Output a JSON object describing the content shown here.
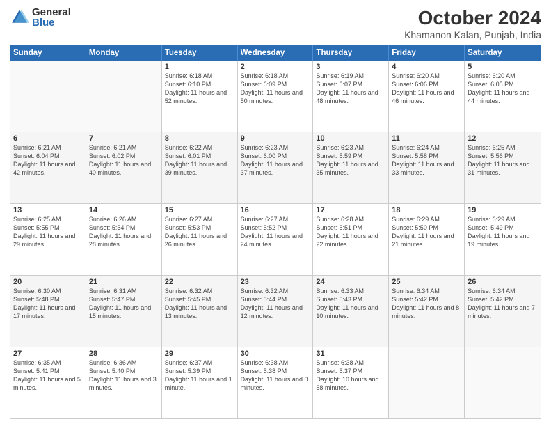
{
  "logo": {
    "general": "General",
    "blue": "Blue"
  },
  "title": "October 2024",
  "subtitle": "Khamanon Kalan, Punjab, India",
  "header_days": [
    "Sunday",
    "Monday",
    "Tuesday",
    "Wednesday",
    "Thursday",
    "Friday",
    "Saturday"
  ],
  "weeks": [
    [
      {
        "day": "",
        "info": ""
      },
      {
        "day": "",
        "info": ""
      },
      {
        "day": "1",
        "info": "Sunrise: 6:18 AM\nSunset: 6:10 PM\nDaylight: 11 hours and 52 minutes."
      },
      {
        "day": "2",
        "info": "Sunrise: 6:18 AM\nSunset: 6:09 PM\nDaylight: 11 hours and 50 minutes."
      },
      {
        "day": "3",
        "info": "Sunrise: 6:19 AM\nSunset: 6:07 PM\nDaylight: 11 hours and 48 minutes."
      },
      {
        "day": "4",
        "info": "Sunrise: 6:20 AM\nSunset: 6:06 PM\nDaylight: 11 hours and 46 minutes."
      },
      {
        "day": "5",
        "info": "Sunrise: 6:20 AM\nSunset: 6:05 PM\nDaylight: 11 hours and 44 minutes."
      }
    ],
    [
      {
        "day": "6",
        "info": "Sunrise: 6:21 AM\nSunset: 6:04 PM\nDaylight: 11 hours and 42 minutes."
      },
      {
        "day": "7",
        "info": "Sunrise: 6:21 AM\nSunset: 6:02 PM\nDaylight: 11 hours and 40 minutes."
      },
      {
        "day": "8",
        "info": "Sunrise: 6:22 AM\nSunset: 6:01 PM\nDaylight: 11 hours and 39 minutes."
      },
      {
        "day": "9",
        "info": "Sunrise: 6:23 AM\nSunset: 6:00 PM\nDaylight: 11 hours and 37 minutes."
      },
      {
        "day": "10",
        "info": "Sunrise: 6:23 AM\nSunset: 5:59 PM\nDaylight: 11 hours and 35 minutes."
      },
      {
        "day": "11",
        "info": "Sunrise: 6:24 AM\nSunset: 5:58 PM\nDaylight: 11 hours and 33 minutes."
      },
      {
        "day": "12",
        "info": "Sunrise: 6:25 AM\nSunset: 5:56 PM\nDaylight: 11 hours and 31 minutes."
      }
    ],
    [
      {
        "day": "13",
        "info": "Sunrise: 6:25 AM\nSunset: 5:55 PM\nDaylight: 11 hours and 29 minutes."
      },
      {
        "day": "14",
        "info": "Sunrise: 6:26 AM\nSunset: 5:54 PM\nDaylight: 11 hours and 28 minutes."
      },
      {
        "day": "15",
        "info": "Sunrise: 6:27 AM\nSunset: 5:53 PM\nDaylight: 11 hours and 26 minutes."
      },
      {
        "day": "16",
        "info": "Sunrise: 6:27 AM\nSunset: 5:52 PM\nDaylight: 11 hours and 24 minutes."
      },
      {
        "day": "17",
        "info": "Sunrise: 6:28 AM\nSunset: 5:51 PM\nDaylight: 11 hours and 22 minutes."
      },
      {
        "day": "18",
        "info": "Sunrise: 6:29 AM\nSunset: 5:50 PM\nDaylight: 11 hours and 21 minutes."
      },
      {
        "day": "19",
        "info": "Sunrise: 6:29 AM\nSunset: 5:49 PM\nDaylight: 11 hours and 19 minutes."
      }
    ],
    [
      {
        "day": "20",
        "info": "Sunrise: 6:30 AM\nSunset: 5:48 PM\nDaylight: 11 hours and 17 minutes."
      },
      {
        "day": "21",
        "info": "Sunrise: 6:31 AM\nSunset: 5:47 PM\nDaylight: 11 hours and 15 minutes."
      },
      {
        "day": "22",
        "info": "Sunrise: 6:32 AM\nSunset: 5:45 PM\nDaylight: 11 hours and 13 minutes."
      },
      {
        "day": "23",
        "info": "Sunrise: 6:32 AM\nSunset: 5:44 PM\nDaylight: 11 hours and 12 minutes."
      },
      {
        "day": "24",
        "info": "Sunrise: 6:33 AM\nSunset: 5:43 PM\nDaylight: 11 hours and 10 minutes."
      },
      {
        "day": "25",
        "info": "Sunrise: 6:34 AM\nSunset: 5:42 PM\nDaylight: 11 hours and 8 minutes."
      },
      {
        "day": "26",
        "info": "Sunrise: 6:34 AM\nSunset: 5:42 PM\nDaylight: 11 hours and 7 minutes."
      }
    ],
    [
      {
        "day": "27",
        "info": "Sunrise: 6:35 AM\nSunset: 5:41 PM\nDaylight: 11 hours and 5 minutes."
      },
      {
        "day": "28",
        "info": "Sunrise: 6:36 AM\nSunset: 5:40 PM\nDaylight: 11 hours and 3 minutes."
      },
      {
        "day": "29",
        "info": "Sunrise: 6:37 AM\nSunset: 5:39 PM\nDaylight: 11 hours and 1 minute."
      },
      {
        "day": "30",
        "info": "Sunrise: 6:38 AM\nSunset: 5:38 PM\nDaylight: 11 hours and 0 minutes."
      },
      {
        "day": "31",
        "info": "Sunrise: 6:38 AM\nSunset: 5:37 PM\nDaylight: 10 hours and 58 minutes."
      },
      {
        "day": "",
        "info": ""
      },
      {
        "day": "",
        "info": ""
      }
    ]
  ]
}
